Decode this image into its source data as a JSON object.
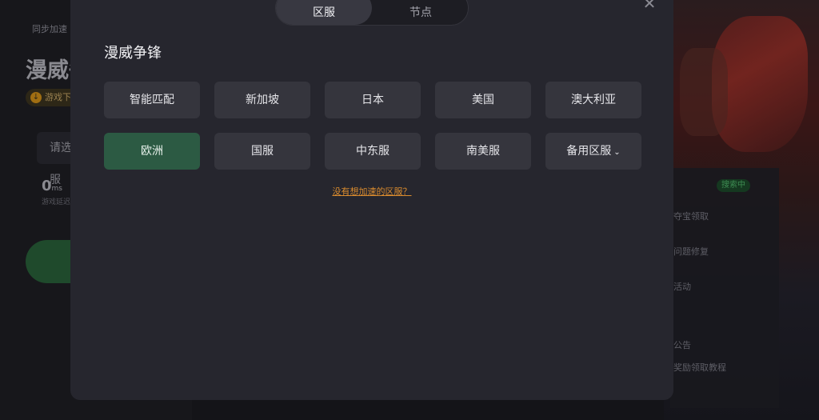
{
  "background": {
    "breadcrumb": "同步加速",
    "game_title": "漫威争锋",
    "badge_text": "游戏下载",
    "select_placeholder": "请选择区服",
    "ping_value": "0",
    "ping_unit": "ms",
    "ping_sub": "游戏延迟",
    "card_tag": "搜索中",
    "card_lines": [
      "夺宝领取",
      "问题修复",
      "活动",
      "公告",
      "奖励领取教程"
    ]
  },
  "modal": {
    "tabs": [
      {
        "label": "区服",
        "active": true
      },
      {
        "label": "节点",
        "active": false
      }
    ],
    "close_icon": "close-icon",
    "game_title": "漫威争锋",
    "regions": [
      {
        "label": "智能匹配",
        "selected": false
      },
      {
        "label": "新加坡",
        "selected": false
      },
      {
        "label": "日本",
        "selected": false
      },
      {
        "label": "美国",
        "selected": false
      },
      {
        "label": "澳大利亚",
        "selected": false
      },
      {
        "label": "欧洲",
        "selected": true
      },
      {
        "label": "国服",
        "selected": false
      },
      {
        "label": "中东服",
        "selected": false
      },
      {
        "label": "南美服",
        "selected": false
      },
      {
        "label": "备用区服",
        "selected": false,
        "dropdown": true
      }
    ],
    "missing_region_link": "没有想加速的区服？"
  },
  "colors": {
    "modal_bg": "#26262e",
    "button_bg": "#35353d",
    "selected_bg": "#2c5a43",
    "link_color": "#d98b2e"
  }
}
